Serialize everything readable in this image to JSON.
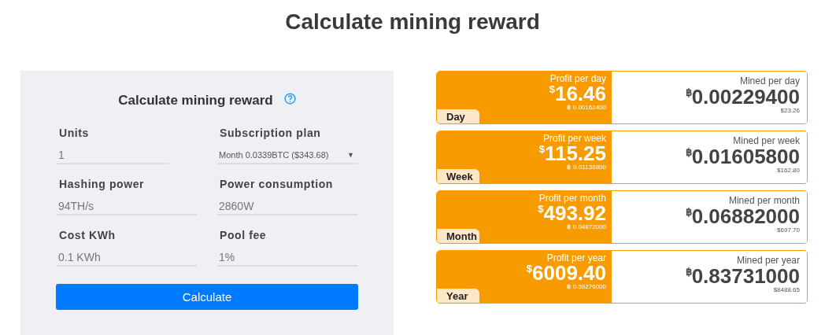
{
  "page_title": "Calculate mining reward",
  "form": {
    "title": "Calculate mining reward",
    "fields": [
      {
        "kind": "input",
        "label": "Units",
        "value": "1",
        "short": true
      },
      {
        "kind": "select",
        "label": "Subscription plan",
        "value": "Month 0.0339BTC ($343.68)",
        "caret": "▼"
      },
      {
        "kind": "input",
        "label": "Hashing power",
        "value": "94TH/s"
      },
      {
        "kind": "input",
        "label": "Power consumption",
        "value": "2860W"
      },
      {
        "kind": "input",
        "label": "Cost KWh",
        "value": "0.1 KWh"
      },
      {
        "kind": "input",
        "label": "Pool fee",
        "value": "1%"
      }
    ],
    "button": "Calculate"
  },
  "periods": [
    {
      "tab": "Day",
      "profit_label": "Profit per day",
      "profit_currency": "$",
      "profit": "16.46",
      "profit_btc_sign": "฿",
      "profit_btc": "0.00162400",
      "mined_label": "Mined per day",
      "mined_currency": "฿",
      "mined": "0.00229400",
      "mined_usd": "$23.26"
    },
    {
      "tab": "Week",
      "profit_label": "Profit per week",
      "profit_currency": "$",
      "profit": "115.25",
      "profit_btc_sign": "฿",
      "profit_btc": "0.01136800",
      "mined_label": "Mined per week",
      "mined_currency": "฿",
      "mined": "0.01605800",
      "mined_usd": "$162.80"
    },
    {
      "tab": "Month",
      "profit_label": "Profit per month",
      "profit_currency": "$",
      "profit": "493.92",
      "profit_btc_sign": "฿",
      "profit_btc": "0.04872000",
      "mined_label": "Mined per month",
      "mined_currency": "฿",
      "mined": "0.06882000",
      "mined_usd": "$697.70"
    },
    {
      "tab": "Year",
      "profit_label": "Profit per year",
      "profit_currency": "$",
      "profit": "6009.40",
      "profit_btc_sign": "฿",
      "profit_btc": "0.59276000",
      "mined_label": "Mined per year",
      "mined_currency": "฿",
      "mined": "0.83731000",
      "mined_usd": "$8488.65"
    }
  ]
}
